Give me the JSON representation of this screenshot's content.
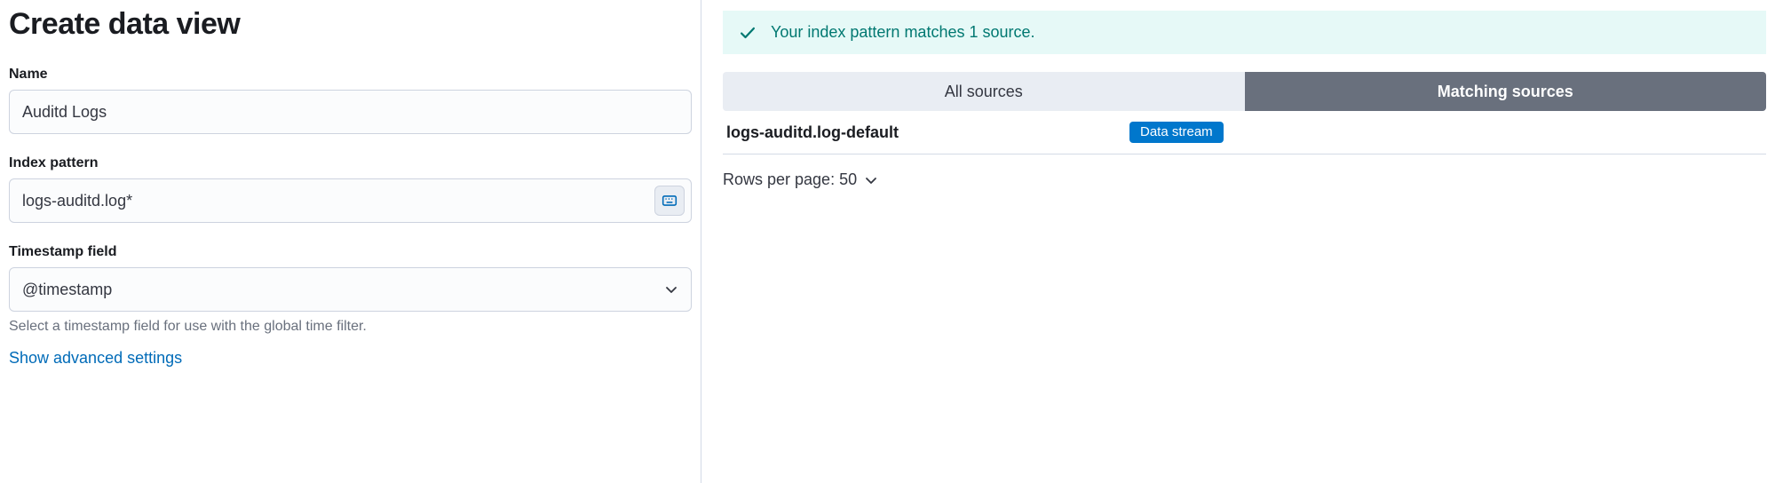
{
  "page": {
    "title": "Create data view"
  },
  "form": {
    "nameLabel": "Name",
    "nameValue": "Auditd Logs",
    "indexPatternLabel": "Index pattern",
    "indexPatternValue": "logs-auditd.log*",
    "timestampLabel": "Timestamp field",
    "timestampValue": "@timestamp",
    "timestampHelp": "Select a timestamp field for use with the global time filter.",
    "advancedLink": "Show advanced settings"
  },
  "callout": {
    "message": "Your index pattern matches 1 source."
  },
  "tabs": {
    "all": "All sources",
    "matching": "Matching sources"
  },
  "sources": [
    {
      "name": "logs-auditd.log-default",
      "badge": "Data stream"
    }
  ],
  "pagination": {
    "label": "Rows per page: 50"
  }
}
